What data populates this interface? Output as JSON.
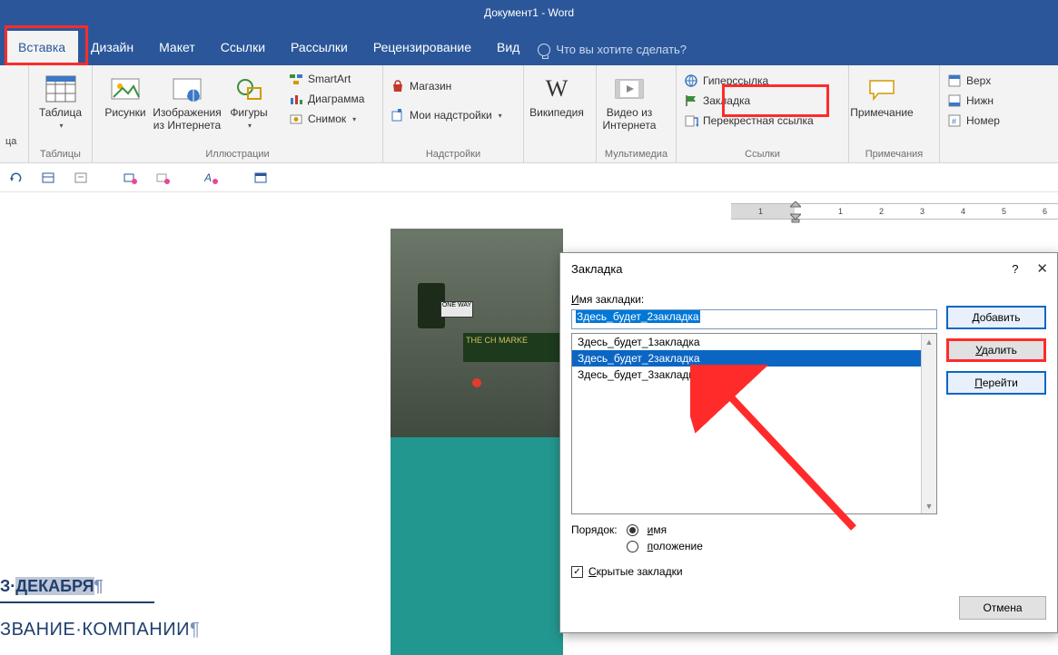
{
  "titlebar": {
    "title": "Документ1 - Word"
  },
  "tabs": {
    "items": [
      {
        "label": "Вставка",
        "active": true
      },
      {
        "label": "Дизайн"
      },
      {
        "label": "Макет"
      },
      {
        "label": "Ссылки"
      },
      {
        "label": "Рассылки"
      },
      {
        "label": "Рецензирование"
      },
      {
        "label": "Вид"
      }
    ],
    "tellme_placeholder": "Что вы хотите сделать?"
  },
  "ribbon": {
    "pages_label": "ца",
    "tables": {
      "group": "Таблицы",
      "table": "Таблица"
    },
    "illustrations": {
      "group": "Иллюстрации",
      "pictures": "Рисунки",
      "online_pictures": "Изображения\nиз Интернета",
      "shapes": "Фигуры",
      "smartart": "SmartArt",
      "chart": "Диаграмма",
      "screenshot": "Снимок"
    },
    "addins": {
      "group": "Надстройки",
      "store": "Магазин",
      "myaddins": "Мои надстройки"
    },
    "wikipedia": "Википедия",
    "media": {
      "group": "Мультимедиа",
      "online_video": "Видео из\nИнтернета"
    },
    "links": {
      "group": "Ссылки",
      "hyperlink": "Гиперссылка",
      "bookmark": "Закладка",
      "crossref": "Перекрестная ссылка"
    },
    "comments": {
      "group": "Примечания",
      "comment": "Примечание"
    },
    "headerfooter": {
      "header": "Верх",
      "footer": "Нижн",
      "page_number": "Номер"
    }
  },
  "ruler_labels": [
    "1",
    "1",
    "2",
    "3",
    "4",
    "5",
    "6"
  ],
  "page": {
    "month_line_pre": "З·",
    "month_line_sel": "ДЕКАБРЯ",
    "company_line": "ЗВАНИЕ·КОМПАНИИ",
    "photo_sign": "ONE WAY",
    "photo_strip": "THE CH\nMARKE"
  },
  "dialog": {
    "title": "Закладка",
    "name_label": "Имя закладки:",
    "name_value": "Здесь_будет_2закладка",
    "items": [
      "Здесь_будет_1закладка",
      "Здесь_будет_2закладка",
      "Здесь_будет_3закладка"
    ],
    "selected_index": 1,
    "order_label": "Порядок:",
    "order_name": "имя",
    "order_location": "положение",
    "hidden_label": "Скрытые закладки",
    "buttons": {
      "add": "Добавить",
      "delete": "Удалить",
      "goto": "Перейти",
      "cancel": "Отмена"
    },
    "help": "?"
  }
}
